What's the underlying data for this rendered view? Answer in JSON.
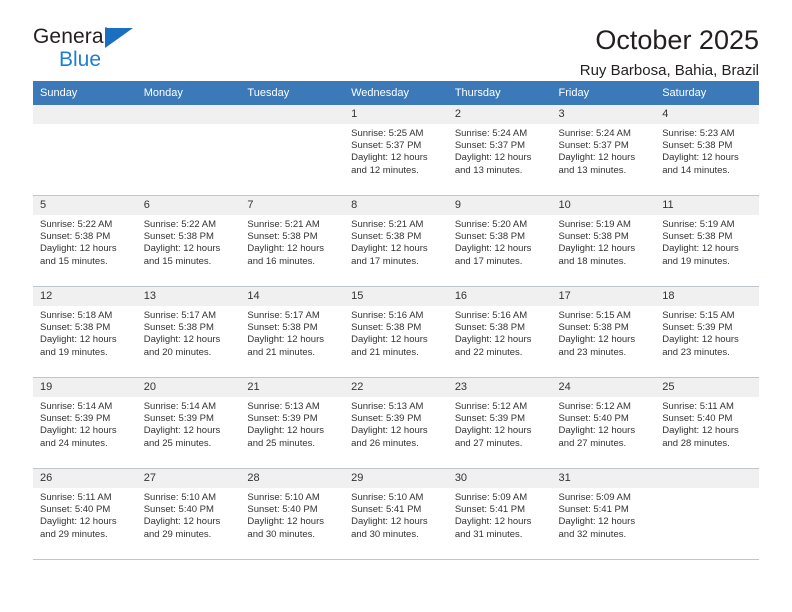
{
  "brand": {
    "line1": "General",
    "line2": "Blue",
    "accent_color": "#1b6fc1"
  },
  "header": {
    "title": "October 2025",
    "subtitle": "Ruy Barbosa, Bahia, Brazil"
  },
  "calendar": {
    "header_bg": "#3b79b8",
    "weekday_headers": [
      "Sunday",
      "Monday",
      "Tuesday",
      "Wednesday",
      "Thursday",
      "Friday",
      "Saturday"
    ],
    "labels": {
      "sunrise": "Sunrise:",
      "sunset": "Sunset:",
      "daylight": "Daylight:"
    },
    "weeks": [
      [
        {
          "day": "",
          "sunrise": "",
          "sunset": "",
          "daylight": "",
          "empty": true
        },
        {
          "day": "",
          "sunrise": "",
          "sunset": "",
          "daylight": "",
          "empty": true
        },
        {
          "day": "",
          "sunrise": "",
          "sunset": "",
          "daylight": "",
          "empty": true
        },
        {
          "day": "1",
          "sunrise": "Sunrise: 5:25 AM",
          "sunset": "Sunset: 5:37 PM",
          "daylight": "Daylight: 12 hours and 12 minutes."
        },
        {
          "day": "2",
          "sunrise": "Sunrise: 5:24 AM",
          "sunset": "Sunset: 5:37 PM",
          "daylight": "Daylight: 12 hours and 13 minutes."
        },
        {
          "day": "3",
          "sunrise": "Sunrise: 5:24 AM",
          "sunset": "Sunset: 5:37 PM",
          "daylight": "Daylight: 12 hours and 13 minutes."
        },
        {
          "day": "4",
          "sunrise": "Sunrise: 5:23 AM",
          "sunset": "Sunset: 5:38 PM",
          "daylight": "Daylight: 12 hours and 14 minutes."
        }
      ],
      [
        {
          "day": "5",
          "sunrise": "Sunrise: 5:22 AM",
          "sunset": "Sunset: 5:38 PM",
          "daylight": "Daylight: 12 hours and 15 minutes."
        },
        {
          "day": "6",
          "sunrise": "Sunrise: 5:22 AM",
          "sunset": "Sunset: 5:38 PM",
          "daylight": "Daylight: 12 hours and 15 minutes."
        },
        {
          "day": "7",
          "sunrise": "Sunrise: 5:21 AM",
          "sunset": "Sunset: 5:38 PM",
          "daylight": "Daylight: 12 hours and 16 minutes."
        },
        {
          "day": "8",
          "sunrise": "Sunrise: 5:21 AM",
          "sunset": "Sunset: 5:38 PM",
          "daylight": "Daylight: 12 hours and 17 minutes."
        },
        {
          "day": "9",
          "sunrise": "Sunrise: 5:20 AM",
          "sunset": "Sunset: 5:38 PM",
          "daylight": "Daylight: 12 hours and 17 minutes."
        },
        {
          "day": "10",
          "sunrise": "Sunrise: 5:19 AM",
          "sunset": "Sunset: 5:38 PM",
          "daylight": "Daylight: 12 hours and 18 minutes."
        },
        {
          "day": "11",
          "sunrise": "Sunrise: 5:19 AM",
          "sunset": "Sunset: 5:38 PM",
          "daylight": "Daylight: 12 hours and 19 minutes."
        }
      ],
      [
        {
          "day": "12",
          "sunrise": "Sunrise: 5:18 AM",
          "sunset": "Sunset: 5:38 PM",
          "daylight": "Daylight: 12 hours and 19 minutes."
        },
        {
          "day": "13",
          "sunrise": "Sunrise: 5:17 AM",
          "sunset": "Sunset: 5:38 PM",
          "daylight": "Daylight: 12 hours and 20 minutes."
        },
        {
          "day": "14",
          "sunrise": "Sunrise: 5:17 AM",
          "sunset": "Sunset: 5:38 PM",
          "daylight": "Daylight: 12 hours and 21 minutes."
        },
        {
          "day": "15",
          "sunrise": "Sunrise: 5:16 AM",
          "sunset": "Sunset: 5:38 PM",
          "daylight": "Daylight: 12 hours and 21 minutes."
        },
        {
          "day": "16",
          "sunrise": "Sunrise: 5:16 AM",
          "sunset": "Sunset: 5:38 PM",
          "daylight": "Daylight: 12 hours and 22 minutes."
        },
        {
          "day": "17",
          "sunrise": "Sunrise: 5:15 AM",
          "sunset": "Sunset: 5:38 PM",
          "daylight": "Daylight: 12 hours and 23 minutes."
        },
        {
          "day": "18",
          "sunrise": "Sunrise: 5:15 AM",
          "sunset": "Sunset: 5:39 PM",
          "daylight": "Daylight: 12 hours and 23 minutes."
        }
      ],
      [
        {
          "day": "19",
          "sunrise": "Sunrise: 5:14 AM",
          "sunset": "Sunset: 5:39 PM",
          "daylight": "Daylight: 12 hours and 24 minutes."
        },
        {
          "day": "20",
          "sunrise": "Sunrise: 5:14 AM",
          "sunset": "Sunset: 5:39 PM",
          "daylight": "Daylight: 12 hours and 25 minutes."
        },
        {
          "day": "21",
          "sunrise": "Sunrise: 5:13 AM",
          "sunset": "Sunset: 5:39 PM",
          "daylight": "Daylight: 12 hours and 25 minutes."
        },
        {
          "day": "22",
          "sunrise": "Sunrise: 5:13 AM",
          "sunset": "Sunset: 5:39 PM",
          "daylight": "Daylight: 12 hours and 26 minutes."
        },
        {
          "day": "23",
          "sunrise": "Sunrise: 5:12 AM",
          "sunset": "Sunset: 5:39 PM",
          "daylight": "Daylight: 12 hours and 27 minutes."
        },
        {
          "day": "24",
          "sunrise": "Sunrise: 5:12 AM",
          "sunset": "Sunset: 5:40 PM",
          "daylight": "Daylight: 12 hours and 27 minutes."
        },
        {
          "day": "25",
          "sunrise": "Sunrise: 5:11 AM",
          "sunset": "Sunset: 5:40 PM",
          "daylight": "Daylight: 12 hours and 28 minutes."
        }
      ],
      [
        {
          "day": "26",
          "sunrise": "Sunrise: 5:11 AM",
          "sunset": "Sunset: 5:40 PM",
          "daylight": "Daylight: 12 hours and 29 minutes."
        },
        {
          "day": "27",
          "sunrise": "Sunrise: 5:10 AM",
          "sunset": "Sunset: 5:40 PM",
          "daylight": "Daylight: 12 hours and 29 minutes."
        },
        {
          "day": "28",
          "sunrise": "Sunrise: 5:10 AM",
          "sunset": "Sunset: 5:40 PM",
          "daylight": "Daylight: 12 hours and 30 minutes."
        },
        {
          "day": "29",
          "sunrise": "Sunrise: 5:10 AM",
          "sunset": "Sunset: 5:41 PM",
          "daylight": "Daylight: 12 hours and 30 minutes."
        },
        {
          "day": "30",
          "sunrise": "Sunrise: 5:09 AM",
          "sunset": "Sunset: 5:41 PM",
          "daylight": "Daylight: 12 hours and 31 minutes."
        },
        {
          "day": "31",
          "sunrise": "Sunrise: 5:09 AM",
          "sunset": "Sunset: 5:41 PM",
          "daylight": "Daylight: 12 hours and 32 minutes."
        },
        {
          "day": "",
          "sunrise": "",
          "sunset": "",
          "daylight": "",
          "empty": true
        }
      ]
    ]
  }
}
